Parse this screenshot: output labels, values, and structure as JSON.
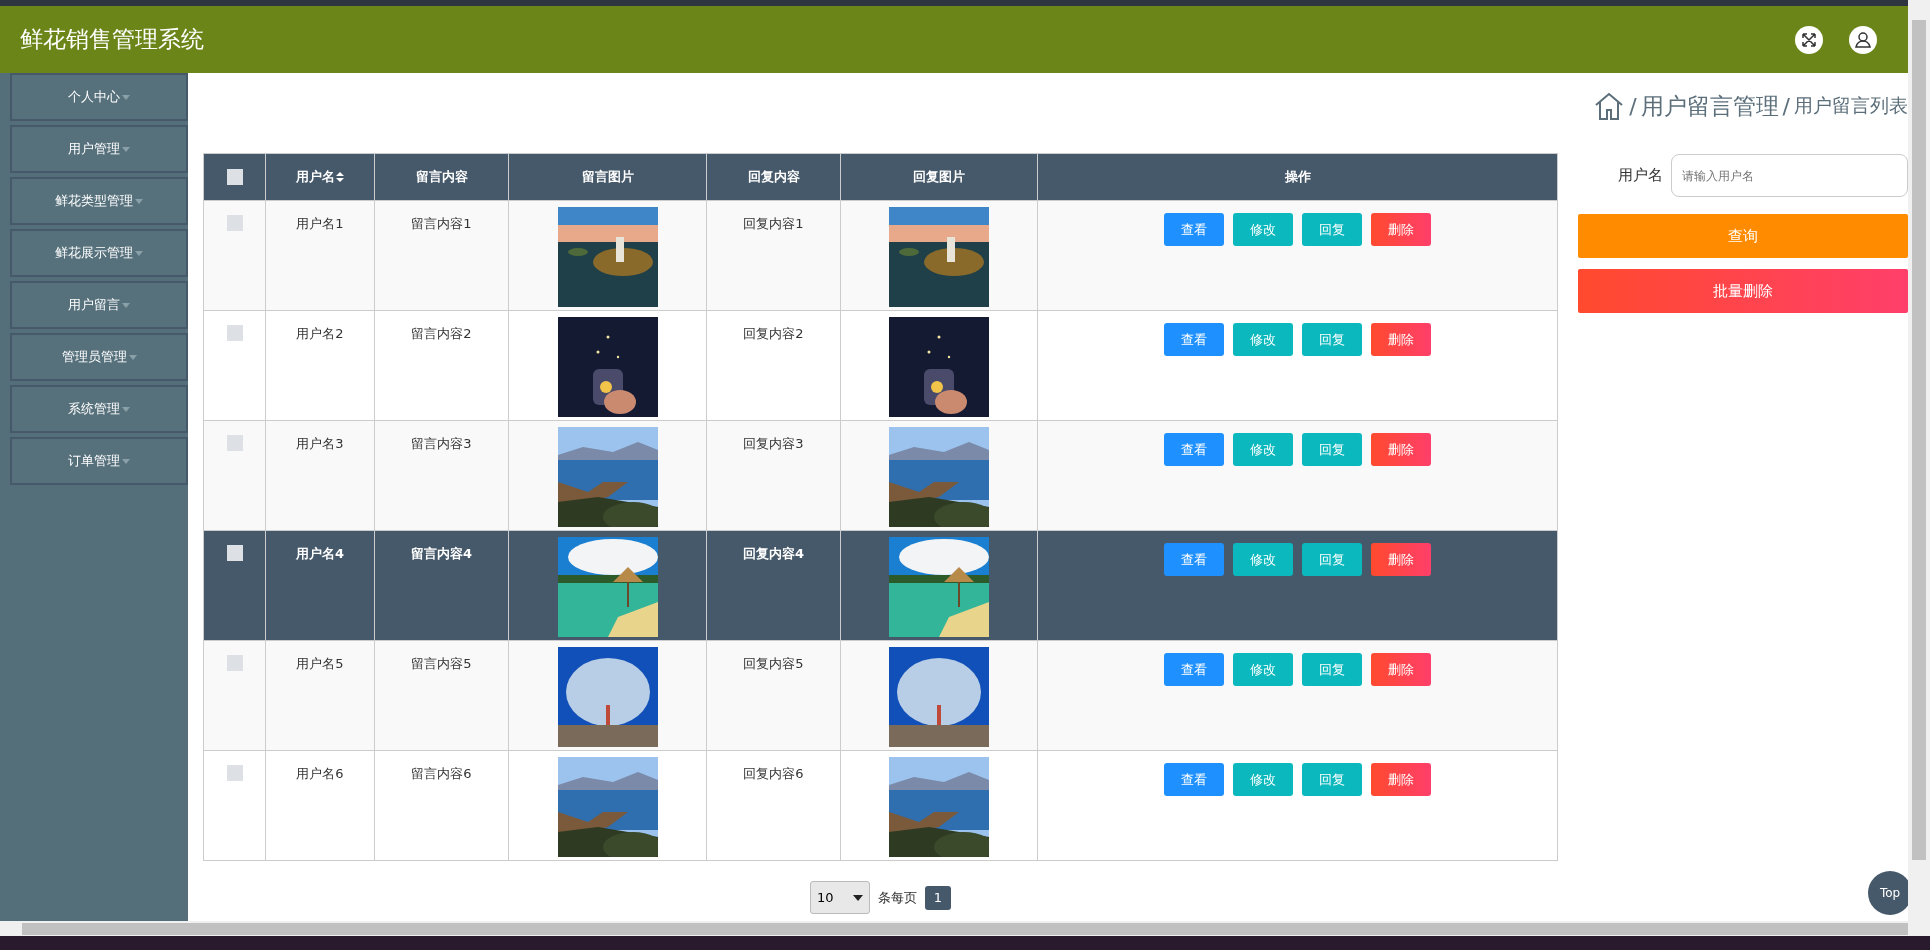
{
  "header": {
    "title": "鲜花销售管理系统"
  },
  "sidebar": {
    "items": [
      {
        "label": "个人中心"
      },
      {
        "label": "用户管理"
      },
      {
        "label": "鲜花类型管理"
      },
      {
        "label": "鲜花展示管理"
      },
      {
        "label": "用户留言"
      },
      {
        "label": "管理员管理"
      },
      {
        "label": "系统管理"
      },
      {
        "label": "订单管理"
      }
    ]
  },
  "breadcrumb": [
    {
      "separator": "/",
      "label": "用户留言管理"
    },
    {
      "separator": "/",
      "label": "用户留言列表"
    }
  ],
  "table": {
    "select_all": {
      "checked": false
    },
    "columns": [
      {
        "label": "用户名",
        "sortable": true
      },
      {
        "label": "留言内容",
        "sortable": false
      },
      {
        "label": "留言图片",
        "sortable": false
      },
      {
        "label": "回复内容",
        "sortable": false
      },
      {
        "label": "回复图片",
        "sortable": false
      },
      {
        "label": "操作",
        "sortable": false
      }
    ],
    "rows": [
      {
        "checked": false,
        "highlighted": false,
        "username": "用户名1",
        "message": "留言内容1",
        "reply": "回复内容1",
        "actions": [
          {
            "kind": "view",
            "label": "查看"
          },
          {
            "kind": "edit",
            "label": "修改"
          },
          {
            "kind": "reply",
            "label": "回复"
          },
          {
            "kind": "delete",
            "label": "删除"
          }
        ]
      },
      {
        "checked": false,
        "highlighted": false,
        "username": "用户名2",
        "message": "留言内容2",
        "reply": "回复内容2",
        "actions": [
          {
            "kind": "view",
            "label": "查看"
          },
          {
            "kind": "edit",
            "label": "修改"
          },
          {
            "kind": "reply",
            "label": "回复"
          },
          {
            "kind": "delete",
            "label": "删除"
          }
        ]
      },
      {
        "checked": false,
        "highlighted": false,
        "username": "用户名3",
        "message": "留言内容3",
        "reply": "回复内容3",
        "actions": [
          {
            "kind": "view",
            "label": "查看"
          },
          {
            "kind": "edit",
            "label": "修改"
          },
          {
            "kind": "reply",
            "label": "回复"
          },
          {
            "kind": "delete",
            "label": "删除"
          }
        ]
      },
      {
        "checked": false,
        "highlighted": true,
        "username": "用户名4",
        "message": "留言内容4",
        "reply": "回复内容4",
        "actions": [
          {
            "kind": "view",
            "label": "查看"
          },
          {
            "kind": "edit",
            "label": "修改"
          },
          {
            "kind": "reply",
            "label": "回复"
          },
          {
            "kind": "delete",
            "label": "删除"
          }
        ]
      },
      {
        "checked": false,
        "highlighted": false,
        "username": "用户名5",
        "message": "留言内容5",
        "reply": "回复内容5",
        "actions": [
          {
            "kind": "view",
            "label": "查看"
          },
          {
            "kind": "edit",
            "label": "修改"
          },
          {
            "kind": "reply",
            "label": "回复"
          },
          {
            "kind": "delete",
            "label": "删除"
          }
        ]
      },
      {
        "checked": false,
        "highlighted": false,
        "username": "用户名6",
        "message": "留言内容6",
        "reply": "回复内容6",
        "actions": [
          {
            "kind": "view",
            "label": "查看"
          },
          {
            "kind": "edit",
            "label": "修改"
          },
          {
            "kind": "reply",
            "label": "回复"
          },
          {
            "kind": "delete",
            "label": "删除"
          }
        ]
      }
    ]
  },
  "search": {
    "label": "用户名",
    "placeholder": "请输入用户名",
    "buttons": [
      {
        "kind": "search",
        "label": "查询"
      },
      {
        "kind": "delete",
        "label": "批量删除"
      }
    ]
  },
  "pagination": {
    "page_size": "10",
    "per_page_label": "条每页",
    "pages": [
      {
        "label": "1",
        "selected": true
      }
    ]
  },
  "back_to_top": "Top"
}
